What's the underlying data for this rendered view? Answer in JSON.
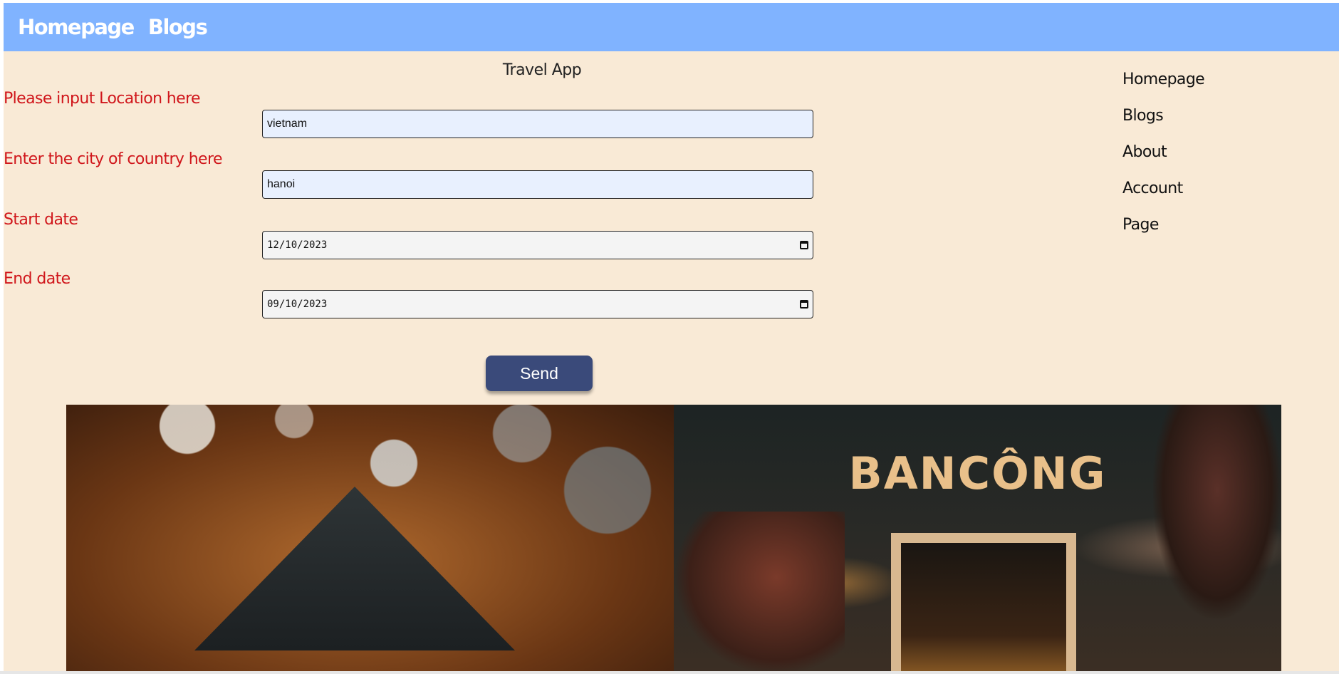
{
  "topnav": {
    "links": [
      "Homepage",
      "Blogs"
    ]
  },
  "form": {
    "title": "Travel App",
    "location": {
      "label": "Please input Location here",
      "value": "vietnam"
    },
    "city": {
      "label": "Enter the city of country here",
      "value": "hanoi"
    },
    "start_date": {
      "label": "Start date",
      "value": "12/10/2023"
    },
    "end_date": {
      "label": "End date",
      "value": "09/10/2023"
    },
    "send_label": "Send"
  },
  "sidenav": {
    "items": [
      "Homepage",
      "Blogs",
      "About",
      "Account",
      "Page"
    ]
  },
  "gallery": {
    "sign_text": "BANCÔNG"
  }
}
